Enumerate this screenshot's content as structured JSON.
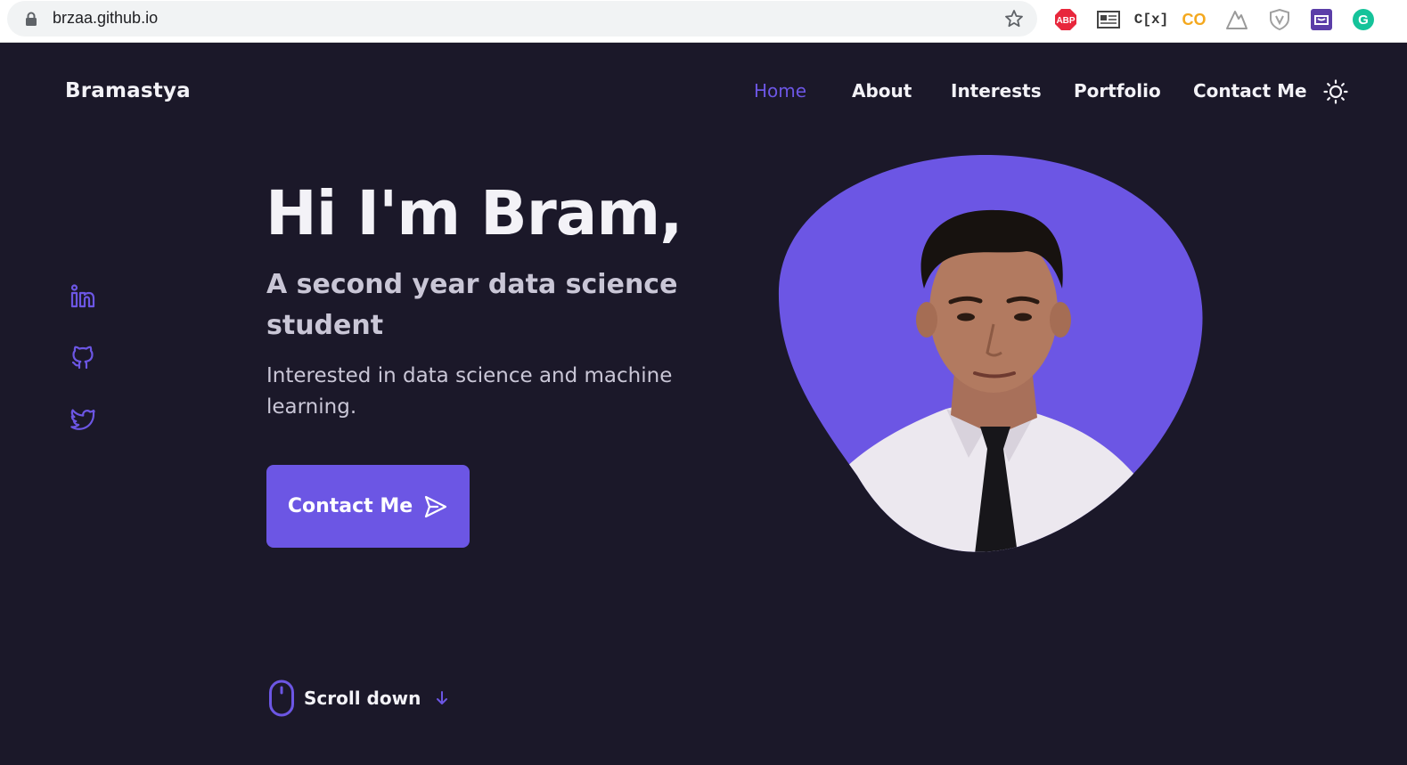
{
  "browser": {
    "url": "brzaa.github.io",
    "extensions": [
      {
        "name": "adblock-plus",
        "label": "ABP",
        "color": "#e8273c"
      },
      {
        "name": "reader",
        "label": "",
        "color": "#444444"
      },
      {
        "name": "cx",
        "label": "C[x]",
        "color": "#333333"
      },
      {
        "name": "co",
        "label": "CO",
        "color": "#f4a81d"
      },
      {
        "name": "mountain",
        "label": "",
        "color": "#9a9a9a"
      },
      {
        "name": "shield",
        "label": "",
        "color": "#a0a0a0"
      },
      {
        "name": "purple-box",
        "label": "",
        "color": "#5b3ea8"
      },
      {
        "name": "grammarly",
        "label": "G",
        "color": "#15c39a"
      }
    ]
  },
  "site": {
    "logo": "Bramastya",
    "nav": [
      {
        "label": "Home",
        "active": true
      },
      {
        "label": "About",
        "active": false
      },
      {
        "label": "Interests",
        "active": false
      },
      {
        "label": "Portfolio",
        "active": false
      },
      {
        "label": "Contact Me",
        "active": false
      }
    ]
  },
  "hero": {
    "title": "Hi I'm Bram,",
    "subtitle": "A second year data science student",
    "description": "Interested in data science and machine learning.",
    "cta_label": "Contact Me"
  },
  "socials": [
    "linkedin-icon",
    "github-icon",
    "twitter-icon"
  ],
  "scroll": {
    "label": "Scroll down"
  },
  "colors": {
    "background": "#1b1829",
    "accent": "#6c56e4",
    "text": "#f3f2f7",
    "muted": "#c9c6d6"
  }
}
